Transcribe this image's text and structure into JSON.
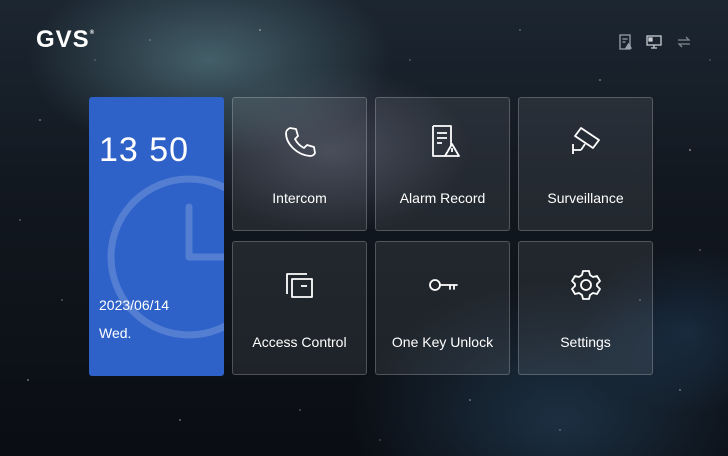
{
  "brand": {
    "logo": "GVS",
    "mark": "®"
  },
  "status_bar": {
    "icons": [
      "alarm-record-status-icon",
      "monitor-status-icon",
      "transfer-status-icon"
    ]
  },
  "clock": {
    "time": "13 50",
    "date": "2023/06/14",
    "weekday": "Wed.",
    "card_color": "#2e62c9"
  },
  "tiles": [
    {
      "label": "Intercom",
      "icon": "phone-icon"
    },
    {
      "label": "Alarm Record",
      "icon": "alarm-record-icon"
    },
    {
      "label": "Surveillance",
      "icon": "camera-icon"
    },
    {
      "label": "Access Control",
      "icon": "access-control-icon"
    },
    {
      "label": "One Key Unlock",
      "icon": "key-icon"
    },
    {
      "label": "Settings",
      "icon": "gear-icon"
    }
  ]
}
